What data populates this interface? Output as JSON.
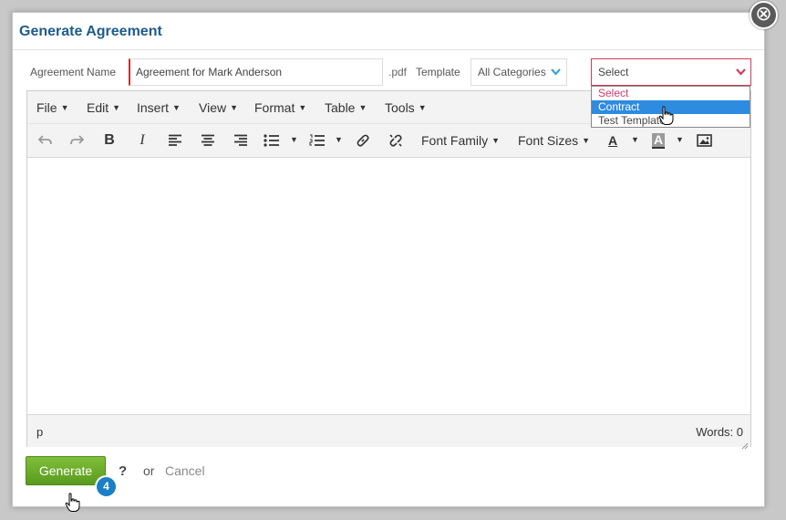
{
  "dialog": {
    "title": "Generate Agreement",
    "close_symbol": "⊗"
  },
  "form": {
    "agreement_name_label": "Agreement Name",
    "agreement_name_value": "Agreement for Mark Anderson",
    "extension": ".pdf",
    "template_label": "Template",
    "category_select_value": "All Categories",
    "template_select_value": "Select",
    "template_options": [
      "Select",
      "Contract",
      "Test Template"
    ],
    "highlighted_option": "Contract"
  },
  "editor": {
    "menus": [
      "File",
      "Edit",
      "Insert",
      "View",
      "Format",
      "Table",
      "Tools"
    ],
    "toolbar": {
      "font_family": "Font Family",
      "font_sizes": "Font Sizes",
      "text_color_glyph": "A",
      "bg_color_glyph": "A"
    },
    "icons": [
      "undo-icon",
      "redo-icon",
      "bold-icon",
      "italic-icon",
      "align-left-icon",
      "align-center-icon",
      "align-right-icon",
      "bullet-list-icon",
      "numbered-list-icon",
      "link-icon",
      "unlink-icon",
      "text-color-icon",
      "background-color-icon",
      "image-icon"
    ],
    "status_path": "p",
    "word_count": "Words: 0"
  },
  "footer": {
    "generate_label": "Generate",
    "badge": "4",
    "help": "?",
    "or": "or",
    "cancel": "Cancel"
  },
  "colors": {
    "title": "#1f5c8b",
    "accent_red": "#d63a5c",
    "highlight_blue": "#2e8be0",
    "generate_green": "#6aaa2b",
    "badge_blue": "#1b7fc7"
  }
}
